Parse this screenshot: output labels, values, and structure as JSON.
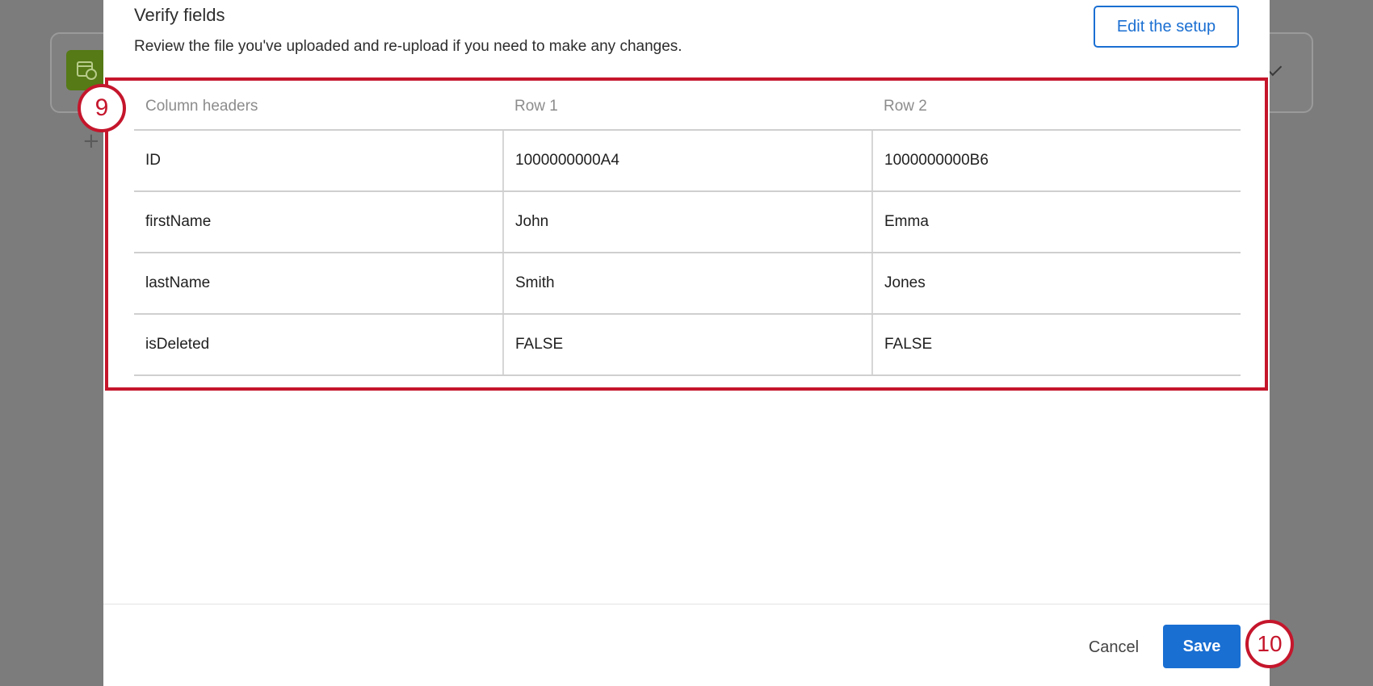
{
  "background": {
    "icon": "calendar-clock-icon",
    "plus_glyph": "+"
  },
  "modal": {
    "title": "Verify fields",
    "subtitle": "Review the file you've uploaded and re-upload if you need to make any changes.",
    "edit_button": "Edit the setup",
    "table": {
      "headers": [
        "Column headers",
        "Row 1",
        "Row 2"
      ],
      "rows": [
        [
          "ID",
          "1000000000A4",
          "1000000000B6"
        ],
        [
          "firstName",
          "John",
          "Emma"
        ],
        [
          "lastName",
          "Smith",
          "Jones"
        ],
        [
          "isDeleted",
          "FALSE",
          "FALSE"
        ]
      ]
    },
    "footer": {
      "cancel_label": "Cancel",
      "save_label": "Save"
    }
  },
  "annotations": {
    "step_9": "9",
    "step_10": "10",
    "highlight_color": "#c5162c"
  },
  "colors": {
    "accent": "#1a6fd2",
    "overlay": "#7c7c7c"
  }
}
